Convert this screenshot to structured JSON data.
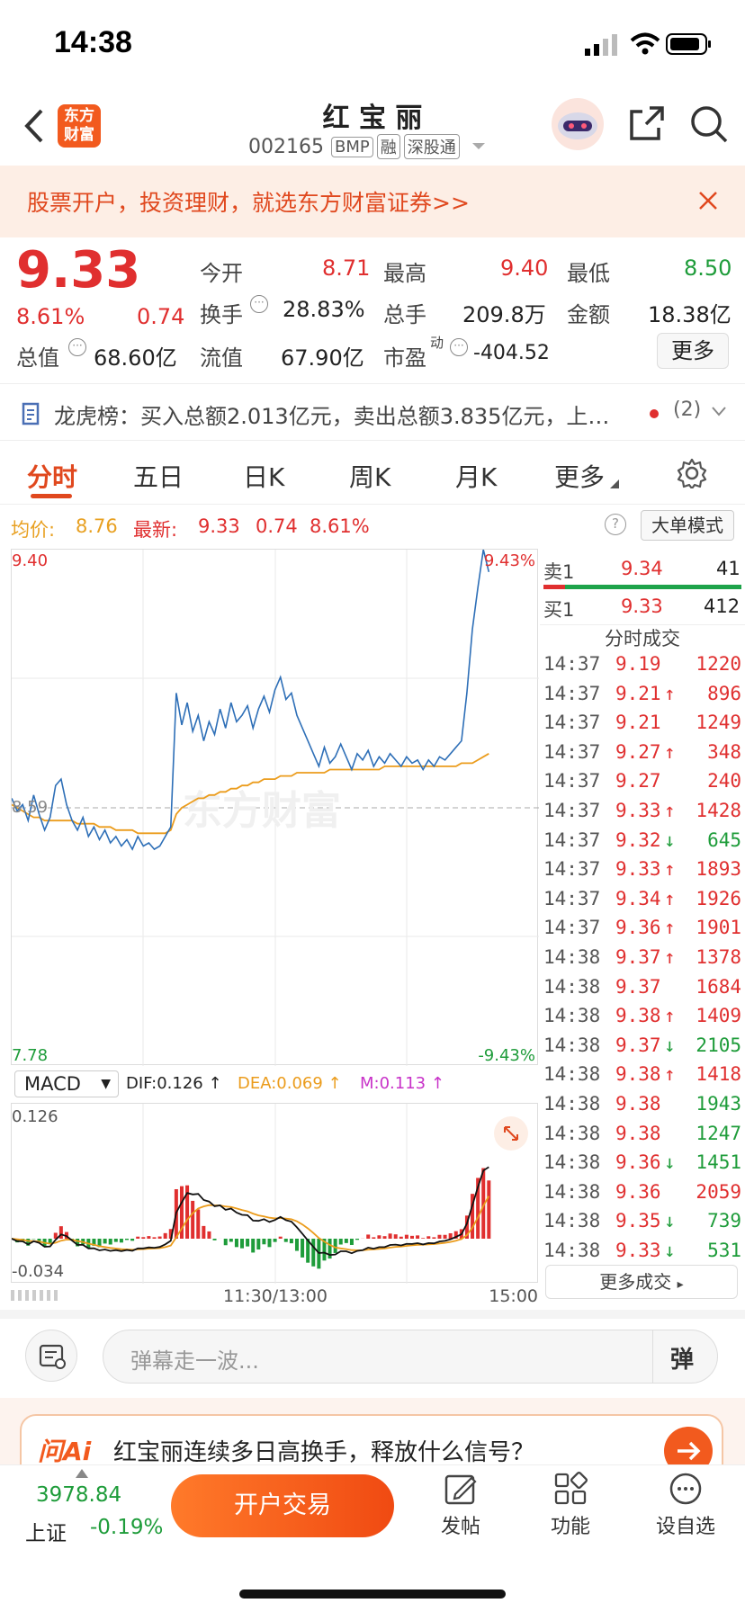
{
  "status": {
    "time": "14:38"
  },
  "header": {
    "logo_line1": "东方",
    "logo_line2": "财富",
    "title": "红 宝 丽",
    "code": "002165",
    "tags": [
      "BMP",
      "融",
      "深股通"
    ]
  },
  "banner": {
    "text": "股票开户，投资理财，就选东方财富证券>>"
  },
  "quote": {
    "price": "9.33",
    "change_pct": "8.61%",
    "change": "0.74",
    "open_label": "今开",
    "open": "8.71",
    "high_label": "最高",
    "high": "9.40",
    "low_label": "最低",
    "low": "8.50",
    "turnover_label": "换手",
    "turnover": "28.83%",
    "volume_label": "总手",
    "volume": "209.8万",
    "amount_label": "金额",
    "amount": "18.38亿",
    "mktcap_label": "总值",
    "mktcap": "68.60亿",
    "float_label": "流值",
    "float": "67.90亿",
    "pe_label": "市盈",
    "pe_sup": "动",
    "pe": "-404.52",
    "more": "更多"
  },
  "lhb": {
    "text": "龙虎榜：买入总额2.013亿元，卖出总额3.835亿元，上…",
    "count": "(2)"
  },
  "tabs": [
    "分时",
    "五日",
    "日K",
    "周K",
    "月K",
    "更多"
  ],
  "priceline": {
    "avg_label": "均价:",
    "avg": "8.76",
    "latest_label": "最新:",
    "latest": "9.33",
    "chg": "0.74",
    "pct": "8.61%",
    "mode": "大单模式"
  },
  "chart_data": {
    "type": "line",
    "title": "",
    "y_top": "9.40",
    "y_bottom": "7.78",
    "y_mid": "8.59",
    "pct_top": "9.43%",
    "pct_bottom": "-9.43%",
    "ylim": [
      7.78,
      9.4
    ],
    "series": [
      {
        "values": [
          8.62,
          8.58,
          8.6,
          8.55,
          8.63,
          8.57,
          8.52,
          8.56,
          8.66,
          8.68,
          8.6,
          8.55,
          8.52,
          8.56,
          8.5,
          8.53,
          8.49,
          8.52,
          8.48,
          8.5,
          8.47,
          8.49,
          8.46,
          8.5,
          8.47,
          8.48,
          8.46,
          8.47,
          8.5,
          8.53,
          8.95,
          8.85,
          8.92,
          8.83,
          8.88,
          8.8,
          8.86,
          8.82,
          8.9,
          8.84,
          8.92,
          8.86,
          8.88,
          8.91,
          8.84,
          8.9,
          8.94,
          8.89,
          8.96,
          9.0,
          8.93,
          8.95,
          8.88,
          8.84,
          8.8,
          8.76,
          8.72,
          8.78,
          8.73,
          8.75,
          8.79,
          8.75,
          8.71,
          8.76,
          8.74,
          8.77,
          8.72,
          8.75,
          8.73,
          8.76,
          8.74,
          8.72,
          8.75,
          8.73,
          8.74,
          8.71,
          8.74,
          8.72,
          8.75,
          8.74,
          8.76,
          8.78,
          8.8,
          8.95,
          9.15,
          9.28,
          9.4,
          9.33
        ]
      },
      {
        "values": [
          8.6,
          8.59,
          8.58,
          8.57,
          8.56,
          8.56,
          8.55,
          8.55,
          8.55,
          8.55,
          8.55,
          8.55,
          8.54,
          8.54,
          8.54,
          8.54,
          8.53,
          8.53,
          8.53,
          8.52,
          8.52,
          8.52,
          8.52,
          8.51,
          8.51,
          8.51,
          8.51,
          8.51,
          8.51,
          8.52,
          8.57,
          8.59,
          8.6,
          8.61,
          8.62,
          8.62,
          8.63,
          8.63,
          8.64,
          8.64,
          8.65,
          8.65,
          8.66,
          8.66,
          8.67,
          8.67,
          8.68,
          8.68,
          8.68,
          8.69,
          8.69,
          8.69,
          8.7,
          8.7,
          8.7,
          8.7,
          8.7,
          8.7,
          8.71,
          8.71,
          8.71,
          8.71,
          8.71,
          8.71,
          8.71,
          8.71,
          8.71,
          8.71,
          8.72,
          8.72,
          8.72,
          8.72,
          8.72,
          8.72,
          8.72,
          8.72,
          8.72,
          8.72,
          8.72,
          8.72,
          8.72,
          8.72,
          8.73,
          8.73,
          8.73,
          8.74,
          8.75,
          8.76
        ]
      }
    ],
    "x_labels": [
      "11:30/13:00",
      "15:00"
    ]
  },
  "orderbook": {
    "ask_label": "卖1",
    "ask_price": "9.34",
    "ask_vol": "41",
    "bid_label": "买1",
    "bid_price": "9.33",
    "bid_vol": "412",
    "trades_title": "分时成交",
    "trades": [
      {
        "t": "14:37",
        "p": "9.19",
        "v": "1220",
        "d": "",
        "c": "red"
      },
      {
        "t": "14:37",
        "p": "9.21",
        "v": "896",
        "d": "↑",
        "c": "red"
      },
      {
        "t": "14:37",
        "p": "9.21",
        "v": "1249",
        "d": "",
        "c": "red"
      },
      {
        "t": "14:37",
        "p": "9.27",
        "v": "348",
        "d": "↑",
        "c": "red"
      },
      {
        "t": "14:37",
        "p": "9.27",
        "v": "240",
        "d": "",
        "c": "red"
      },
      {
        "t": "14:37",
        "p": "9.33",
        "v": "1428",
        "d": "↑",
        "c": "red"
      },
      {
        "t": "14:37",
        "p": "9.32",
        "v": "645",
        "d": "↓",
        "c": "green"
      },
      {
        "t": "14:37",
        "p": "9.33",
        "v": "1893",
        "d": "↑",
        "c": "red"
      },
      {
        "t": "14:37",
        "p": "9.34",
        "v": "1926",
        "d": "↑",
        "c": "red"
      },
      {
        "t": "14:37",
        "p": "9.36",
        "v": "1901",
        "d": "↑",
        "c": "red"
      },
      {
        "t": "14:38",
        "p": "9.37",
        "v": "1378",
        "d": "↑",
        "c": "red"
      },
      {
        "t": "14:38",
        "p": "9.37",
        "v": "1684",
        "d": "",
        "c": "red"
      },
      {
        "t": "14:38",
        "p": "9.38",
        "v": "1409",
        "d": "↑",
        "c": "red"
      },
      {
        "t": "14:38",
        "p": "9.37",
        "v": "2105",
        "d": "↓",
        "c": "green"
      },
      {
        "t": "14:38",
        "p": "9.38",
        "v": "1418",
        "d": "↑",
        "c": "red"
      },
      {
        "t": "14:38",
        "p": "9.38",
        "v": "1943",
        "d": "",
        "c": "green"
      },
      {
        "t": "14:38",
        "p": "9.38",
        "v": "1247",
        "d": "",
        "c": "green"
      },
      {
        "t": "14:38",
        "p": "9.36",
        "v": "1451",
        "d": "↓",
        "c": "green"
      },
      {
        "t": "14:38",
        "p": "9.36",
        "v": "2059",
        "d": "",
        "c": "red"
      },
      {
        "t": "14:38",
        "p": "9.35",
        "v": "739",
        "d": "↓",
        "c": "green"
      },
      {
        "t": "14:38",
        "p": "9.33",
        "v": "531",
        "d": "↓",
        "c": "green"
      }
    ],
    "more": "更多成交"
  },
  "macd": {
    "select": "MACD",
    "dif": "DIF:0.126 ↑",
    "dea": "DEA:0.069 ↑",
    "m": "M:0.113 ↑",
    "top": "0.126",
    "bottom": "-0.034"
  },
  "comment": {
    "placeholder": "弹幕走一波...",
    "btn": "弹"
  },
  "askai": {
    "logo": "问Ai",
    "text": "红宝丽连续多日高换手，释放什么信号？"
  },
  "bottom": {
    "index_value": "3978.84",
    "index_name": "上证",
    "index_pct": "-0.19%",
    "trade_btn": "开户交易",
    "post": "发帖",
    "func": "功能",
    "watch": "设自选"
  }
}
